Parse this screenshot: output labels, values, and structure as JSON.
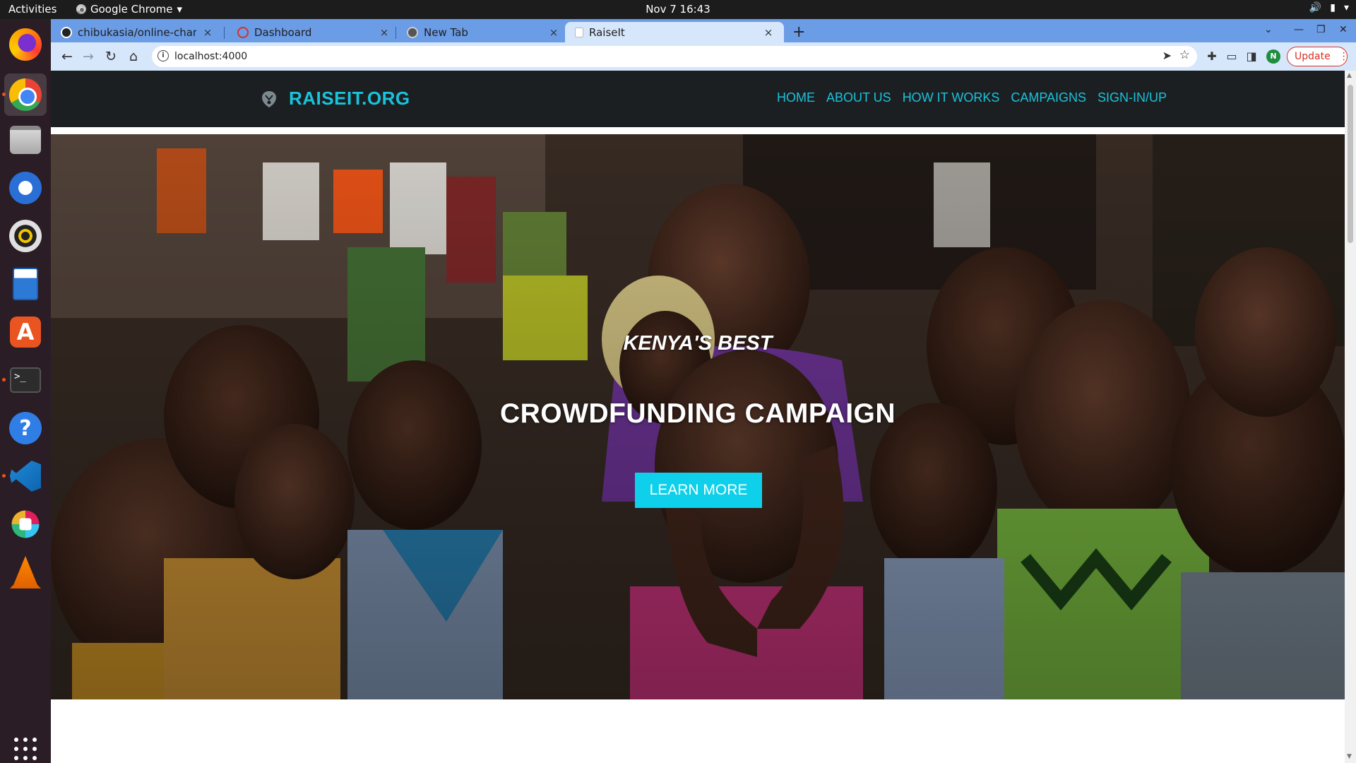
{
  "system": {
    "activities": "Activities",
    "app_menu": "Google Chrome",
    "app_menu_caret": "▾",
    "clock": "Nov 7  16:43"
  },
  "dock": {
    "apps": [
      "firefox-icon",
      "chrome-icon",
      "files-icon",
      "thunderbird-icon",
      "rhythmbox-icon",
      "libreoffice-writer-icon",
      "ubuntu-software-icon",
      "terminal-icon",
      "help-icon",
      "vscode-icon",
      "slack-icon",
      "vlc-icon"
    ],
    "accent": "#e95420"
  },
  "browser": {
    "tabs": [
      {
        "title": "chibukasia/online-charity",
        "favicon": "github-icon"
      },
      {
        "title": "Dashboard",
        "favicon": "loading-icon"
      },
      {
        "title": "New Tab",
        "favicon": "chrome-icon"
      },
      {
        "title": "RaiseIt",
        "favicon": "page-icon"
      }
    ],
    "active_tab": 3,
    "close_glyph": "×",
    "new_tab_glyph": "+",
    "url": "localhost:4000",
    "profile_initial": "N",
    "update_label": "Update",
    "update_more": "⋮",
    "colors": {
      "tabstrip": "#6b9ce6",
      "toolbar": "#d6e6fb",
      "update": "#d93025"
    }
  },
  "site": {
    "brand": "RAISEIT.ORG",
    "nav": [
      "HOME",
      "ABOUT US",
      "HOW IT WORKS",
      "CAMPAIGNS",
      "SIGN-IN/UP"
    ],
    "hero": {
      "subtitle": "KENYA'S BEST",
      "title": "CROWDFUNDING CAMPAIGN",
      "cta": "LEARN MORE"
    },
    "colors": {
      "accent": "#19c3dd",
      "header_bg": "#1c1f21",
      "cta_bg": "#0fd0ea"
    }
  }
}
